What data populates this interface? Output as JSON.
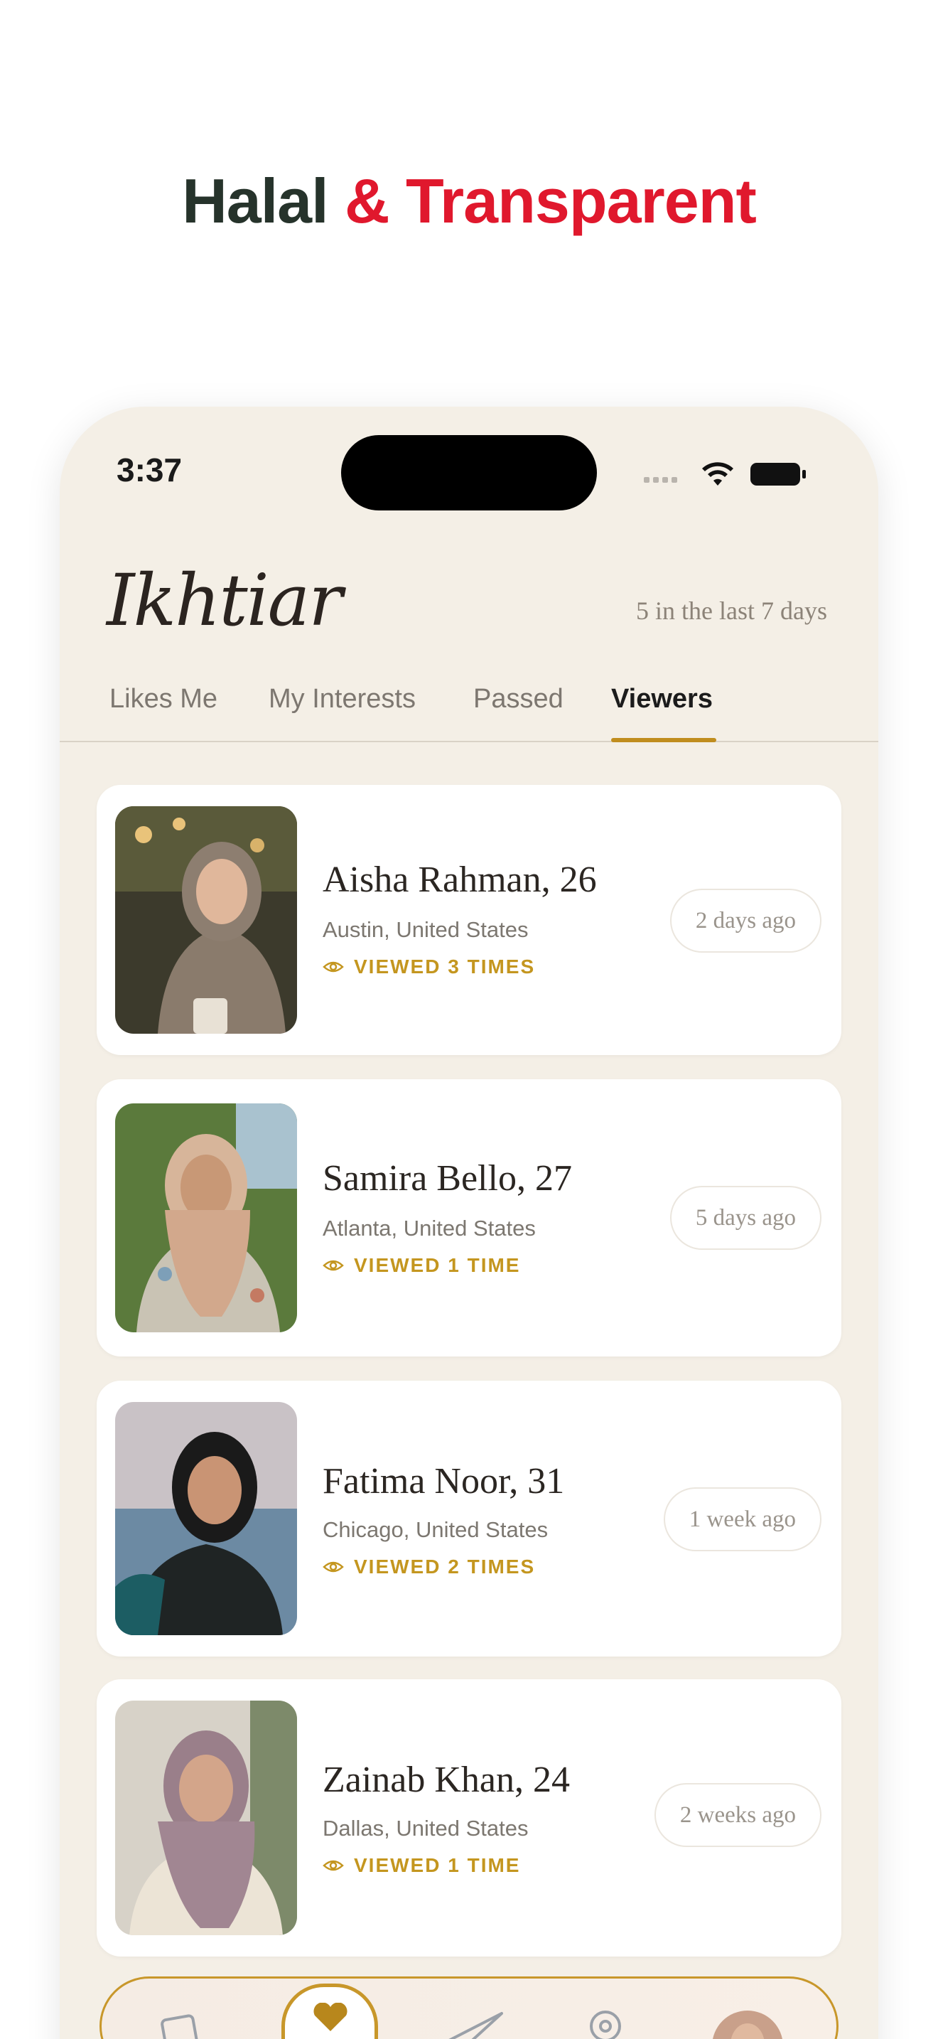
{
  "headline": {
    "part1": "Halal",
    "part2": "& Transparent"
  },
  "status_bar": {
    "time": "3:37"
  },
  "app": {
    "brand": "Ikhtiar",
    "meta": "5 in the last 7 days"
  },
  "tabs": [
    {
      "label": "Likes Me",
      "active": false
    },
    {
      "label": "My Interests",
      "active": false
    },
    {
      "label": "Passed",
      "active": false
    },
    {
      "label": "Viewers",
      "active": true
    }
  ],
  "viewers": [
    {
      "name": "Aisha Rahman, 26",
      "location": "Austin, United States",
      "views": "VIEWED 3 TIMES",
      "when": "2 days ago"
    },
    {
      "name": "Samira Bello, 27",
      "location": "Atlanta, United States",
      "views": "VIEWED 1 TIME",
      "when": "5 days ago"
    },
    {
      "name": "Fatima Noor, 31",
      "location": "Chicago, United States",
      "views": "VIEWED 2 TIMES",
      "when": "1 week ago"
    },
    {
      "name": "Zainab Khan, 24",
      "location": "Dallas, United States",
      "views": "VIEWED 1 TIME",
      "when": "2 weeks ago"
    }
  ],
  "colors": {
    "accent": "#c08d1e",
    "headline_dark": "#26332b",
    "headline_red": "#e0182d",
    "background": "#f4efe6"
  },
  "bottom_nav": [
    "cards-icon",
    "heart-icon",
    "send-icon",
    "location-icon",
    "avatar"
  ]
}
